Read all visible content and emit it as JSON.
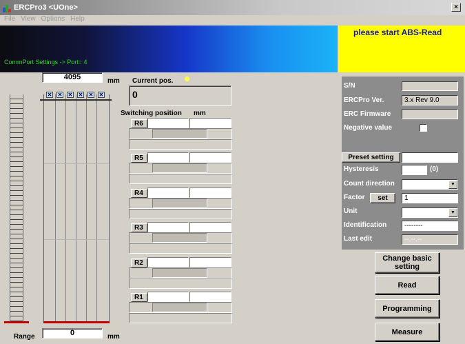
{
  "window": {
    "title": "ERCPro3 <UOne>",
    "close": "×"
  },
  "menu": [
    "File",
    "View",
    "Options",
    "Help"
  ],
  "banner": {
    "comm_text": "CommPort Settings -> Port= 4",
    "message": "please start ABS-Read"
  },
  "scale": {
    "top_value": "4095",
    "top_unit": "mm",
    "range_label": "Range",
    "range_value": "0",
    "range_unit": "mm"
  },
  "current": {
    "label": "Current pos.",
    "value": "0"
  },
  "switching": {
    "label": "Switching position",
    "unit": "mm",
    "rows": [
      "R6",
      "R5",
      "R4",
      "R3",
      "R2",
      "R1"
    ]
  },
  "panel": {
    "sn_label": "S/N",
    "ercpro_ver_label": "ERCPro Ver.",
    "ercpro_ver_value": "3.x Rev 9.0",
    "erc_firmware_label": "ERC Firmware",
    "negative_value_label": "Negative value",
    "preset_button": "Preset setting",
    "hysteresis_label": "Hysteresis",
    "hysteresis_suffix": "(0)",
    "count_direction_label": "Count direction",
    "factor_label": "Factor",
    "factor_set": "set",
    "factor_value": "1",
    "unit_label": "Unit",
    "identification_label": "Identification",
    "identification_value": "--------",
    "last_edit_label": "Last edit",
    "last_edit_value": "--.--.--"
  },
  "buttons": {
    "change_basic": "Change basic setting",
    "read": "Read",
    "programming": "Programming",
    "measure": "Measure"
  },
  "colors": {
    "banner_message": "#ffff00",
    "comm_text": "#2bd82b",
    "range_line": "#c00000",
    "indicator": "#ffff40"
  }
}
